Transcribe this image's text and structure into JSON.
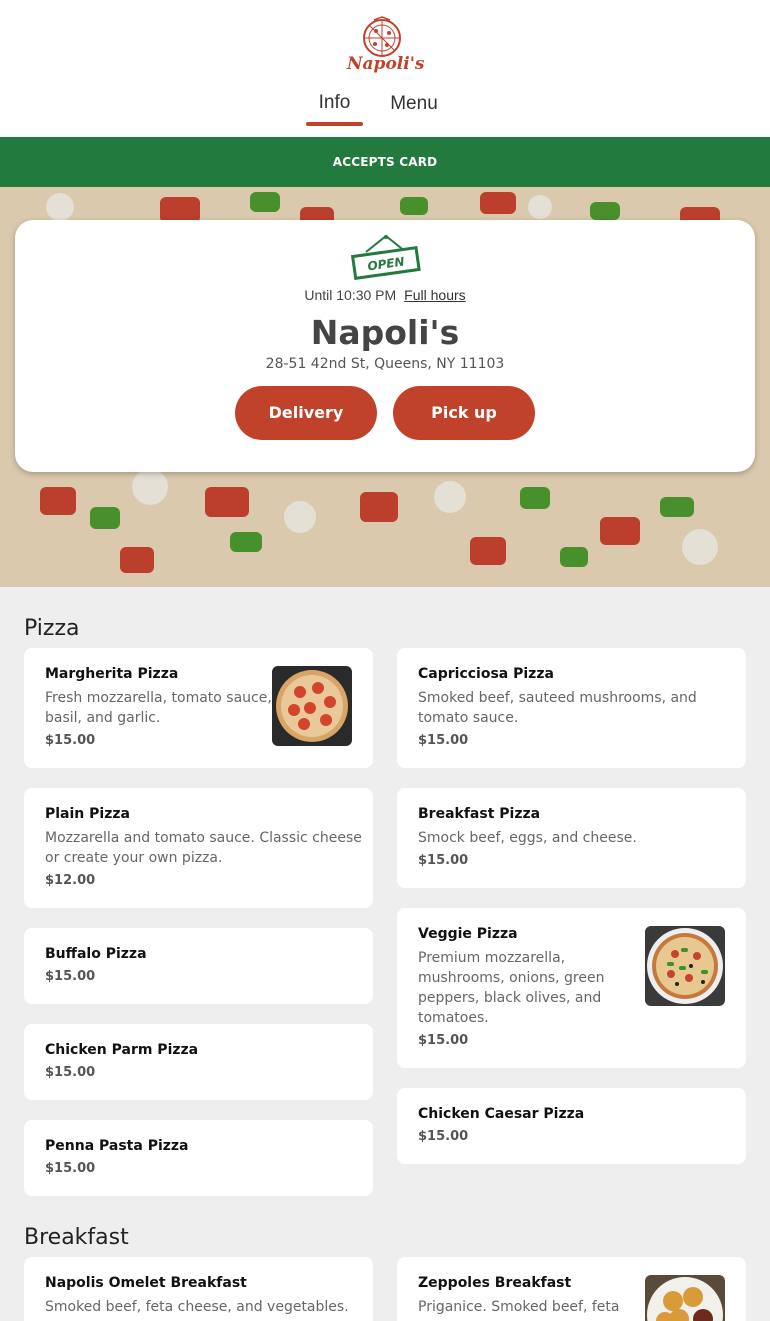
{
  "header": {
    "logo_text": "Napoli's",
    "tabs": [
      {
        "label": "Info"
      },
      {
        "label": "Menu"
      }
    ]
  },
  "banner": {
    "text": "ACCEPTS CARD"
  },
  "info_card": {
    "open_sign_text": "OPEN",
    "hours_text": "Until 10:30 PM",
    "full_hours_link": "Full hours",
    "name": "Napoli's",
    "address": "28-51 42nd St, Queens, NY 11103",
    "delivery_label": "Delivery",
    "pickup_label": "Pick up"
  },
  "colors": {
    "accent": "#c0422b",
    "banner": "#237a3f",
    "background": "#eeeeee"
  },
  "menu": {
    "pizza": {
      "title": "Pizza",
      "items": [
        {
          "name": "Margherita Pizza",
          "desc": [
            "Fresh mozzarella, tomato sauce,",
            "basil, and garlic."
          ],
          "price": "$15.00",
          "image": "margherita-pizza-photo"
        },
        {
          "name": "Capricciosa Pizza",
          "desc": [
            "Smoked beef, sauteed mushrooms, and",
            "tomato sauce."
          ],
          "price": "$15.00"
        },
        {
          "name": "Plain Pizza",
          "desc": [
            "Mozzarella and tomato sauce. Classic cheese",
            "or create your own pizza."
          ],
          "price": "$12.00"
        },
        {
          "name": "Breakfast Pizza",
          "desc": [
            "Smock beef, eggs, and cheese."
          ],
          "price": "$15.00"
        },
        {
          "name": "Buffalo Pizza",
          "price": "$15.00"
        },
        {
          "name": "Veggie Pizza",
          "desc": [
            "Premium mozzarella,",
            "mushrooms, onions, green",
            "peppers, black olives, and",
            "tomatoes."
          ],
          "price": "$15.00",
          "image": "veggie-pizza-photo"
        },
        {
          "name": "Chicken Parm Pizza",
          "price": "$15.00"
        },
        {
          "name": "Chicken Caesar Pizza",
          "price": "$15.00"
        },
        {
          "name": "Penna Pasta Pizza",
          "price": "$15.00"
        }
      ]
    },
    "breakfast": {
      "title": "Breakfast",
      "items": [
        {
          "name": "Napolis Omelet Breakfast",
          "desc": [
            "Smoked beef, feta cheese, and vegetables."
          ]
        },
        {
          "name": "Zeppoles Breakfast",
          "desc": [
            "Priganice. Smoked beef, feta"
          ],
          "image": "zeppoles-photo"
        }
      ]
    }
  }
}
